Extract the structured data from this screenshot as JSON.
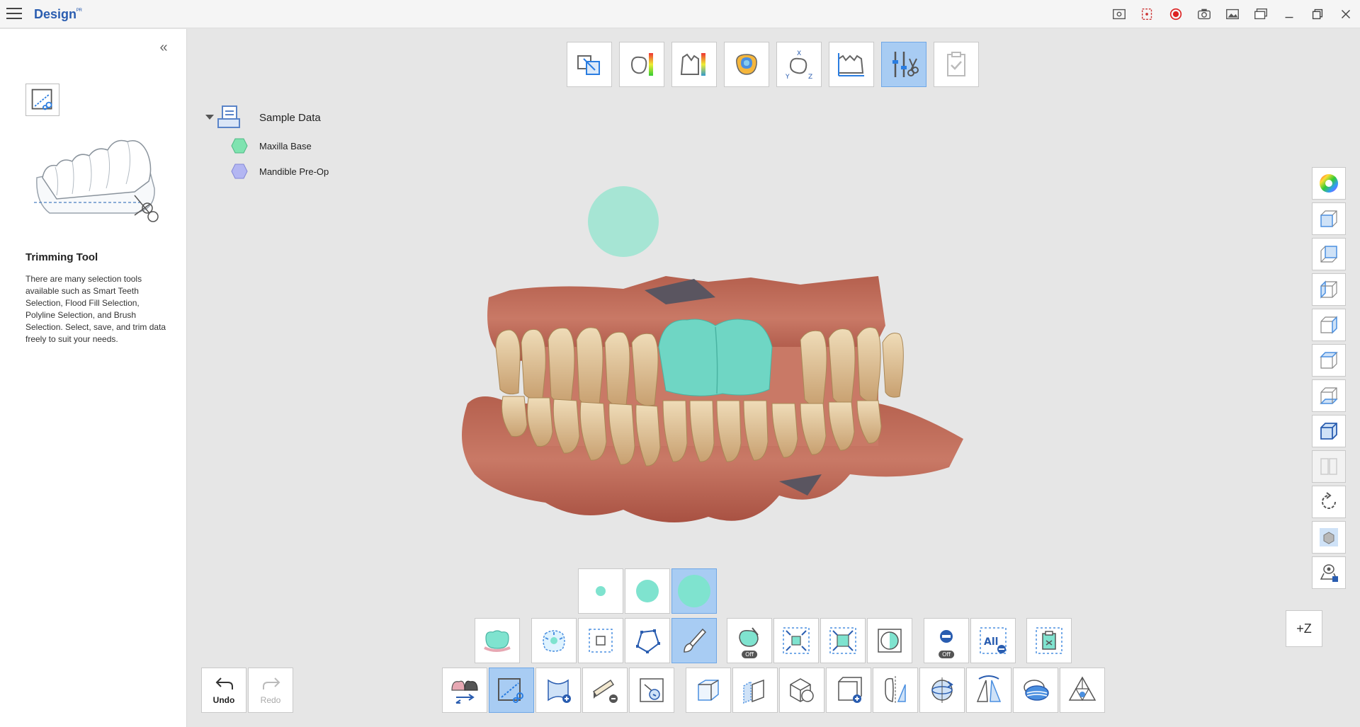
{
  "app": {
    "title": "Design",
    "badge": "ᴾᴿ"
  },
  "left_panel": {
    "collapse_glyph": "«",
    "tool_title": "Trimming Tool",
    "tool_description": "There are many selection tools available such as Smart Teeth Selection, Flood Fill Selection, Polyline Selection, and Brush Selection. Select, save, and trim data freely to suit your needs."
  },
  "data_tree": {
    "root_label": "Sample Data",
    "items": [
      {
        "label": "Maxilla Base",
        "color": "#7fe3b0"
      },
      {
        "label": "Mandible Pre-Op",
        "color": "#b3b6f2"
      }
    ]
  },
  "history": {
    "undo_label": "Undo",
    "redo_label": "Redo"
  },
  "toggle_tags": {
    "off": "Off",
    "all": "All"
  },
  "view": {
    "axis_label": "+Z"
  },
  "colors": {
    "accent": "#2a5db0",
    "active_button": "#a8ccf3",
    "selection_teal": "#7fe3cf"
  }
}
